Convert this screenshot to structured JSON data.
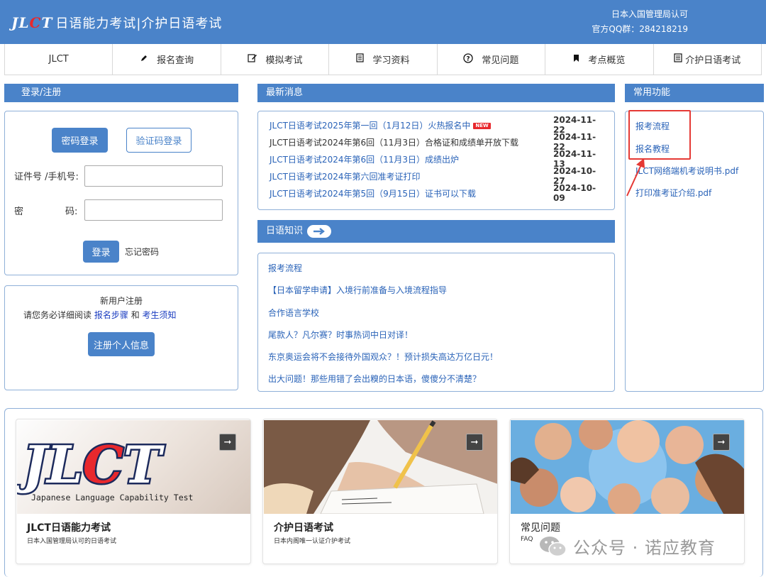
{
  "header": {
    "logo_mark_1": "JL",
    "logo_mark_2": "C",
    "logo_mark_3": "T",
    "logo_text": "日语能力考试|介护日语考试",
    "right_line1": "日本入国管理局认可",
    "right_line2": "官方QQ群：284218219"
  },
  "nav": [
    {
      "label": "JLCT",
      "icon": ""
    },
    {
      "label": "报名查询",
      "icon": "pencil-icon"
    },
    {
      "label": "模拟考试",
      "icon": "edit-icon"
    },
    {
      "label": "学习资料",
      "icon": "document-icon"
    },
    {
      "label": "常见问题",
      "icon": "question-icon"
    },
    {
      "label": "考点概览",
      "icon": "bookmark-icon"
    },
    {
      "label": "介护日语考试",
      "icon": "book-icon"
    }
  ],
  "login": {
    "title": "登录/注册",
    "tab_password": "密码登录",
    "tab_code": "验证码登录",
    "id_label": "证件号 /手机号:",
    "pwd_label_1": "密",
    "pwd_label_2": "码:",
    "login_button": "登录",
    "forgot": "忘记密码"
  },
  "register": {
    "title": "新用户注册",
    "notice_prefix": "请您务必详细阅读",
    "link1": "报名步骤",
    "and": "和",
    "link2": "考生须知",
    "button": "注册个人信息"
  },
  "news": {
    "title": "最新消息",
    "items": [
      {
        "title": "JLCT日语考试2025年第一回（1月12日）火热报名中",
        "date": "2024-11-22",
        "badge": "NEW",
        "dark": false
      },
      {
        "title": "JLCT日语考试2024年第6回（11月3日）合格证和成绩单开放下载",
        "date": "2024-11-22",
        "badge": "",
        "dark": true
      },
      {
        "title": "JLCT日语考试2024年第6回（11月3日）成绩出炉",
        "date": "2024-11-13",
        "badge": "",
        "dark": false
      },
      {
        "title": "JLCT日语考试2024年第六回准考证打印",
        "date": "2024-10-27",
        "badge": "",
        "dark": false
      },
      {
        "title": "JLCT日语考试2024年第5回（9月15日）证书可以下载",
        "date": "2024-10-09",
        "badge": "",
        "dark": false
      }
    ]
  },
  "knowledge": {
    "title": "日语知识",
    "items": [
      "报考流程",
      "【日本留学申请】入境行前准备与入境流程指导",
      "合作语言学校",
      "尾款人？凡尔赛？时事热词中日对译！",
      "东京奥运会将不会接待外国观众？！预计损失高达万亿日元！",
      "出大问题！那些用错了会出糗的日本语，傻傻分不清楚？"
    ]
  },
  "functions": {
    "title": "常用功能",
    "items": [
      "报考流程",
      "报名教程",
      "JLCT网络端机考说明书.pdf",
      "打印准考证介绍.pdf"
    ]
  },
  "cards": [
    {
      "title": "JLCT日语能力考试",
      "sub": "日本入国管理局认可的日语考试",
      "img_text": "JLCT",
      "img_caption": "Japanese Language Capability Test"
    },
    {
      "title": "介护日语考试",
      "sub": "日本内阁唯一认证介护考试"
    },
    {
      "title": "常见问题",
      "sub": "FAQ"
    }
  ],
  "watermark": "公众号 · 诺应教育",
  "colors": {
    "brand": "#4a83c9",
    "accent_red": "#e8282d",
    "link": "#2a63b8"
  }
}
